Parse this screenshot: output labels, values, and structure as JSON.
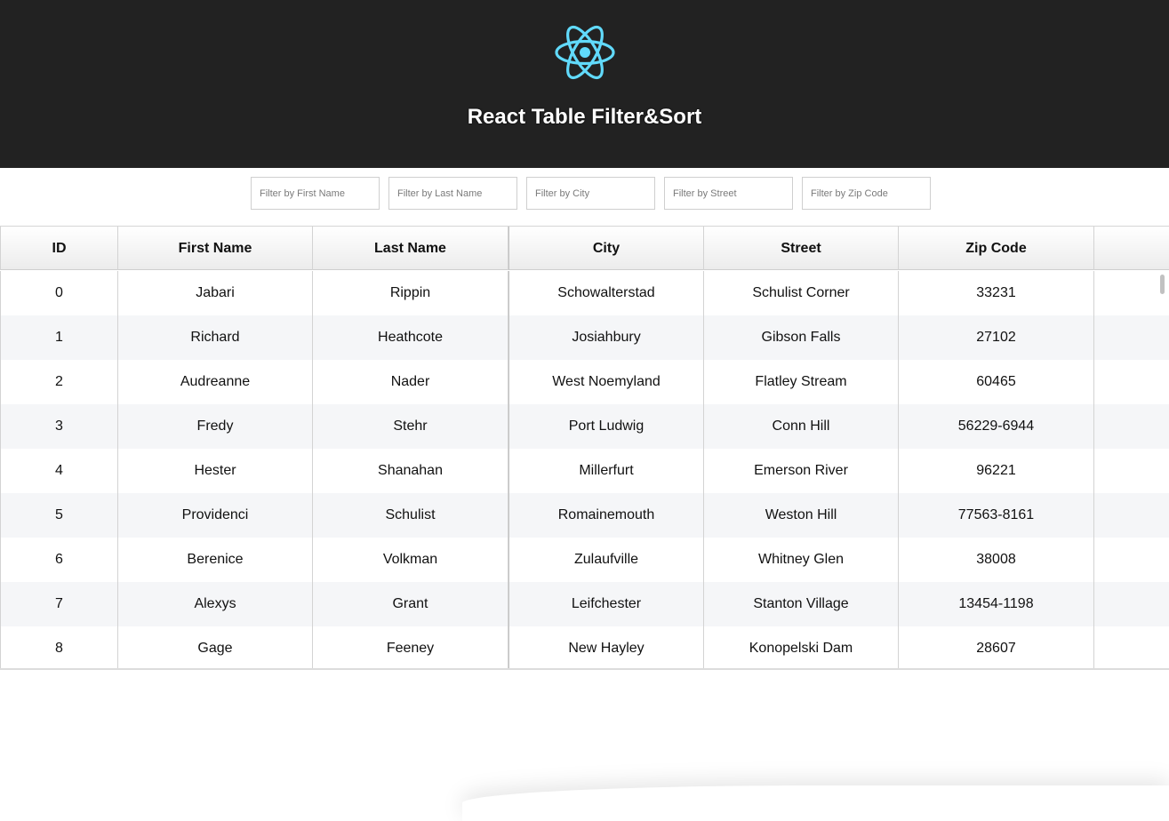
{
  "header": {
    "logo_icon": "react-atom-icon",
    "logo_color": "#61dafb",
    "title": "React Table Filter&Sort",
    "background": "#222222"
  },
  "filters": [
    {
      "placeholder": "Filter by First Name",
      "value": ""
    },
    {
      "placeholder": "Filter by Last Name",
      "value": ""
    },
    {
      "placeholder": "Filter by City",
      "value": ""
    },
    {
      "placeholder": "Filter by Street",
      "value": ""
    },
    {
      "placeholder": "Filter by Zip Code",
      "value": ""
    }
  ],
  "table": {
    "columns": [
      "ID",
      "First Name",
      "Last Name",
      "City",
      "Street",
      "Zip Code",
      ""
    ],
    "rows": [
      [
        "0",
        "Jabari",
        "Rippin",
        "Schowalterstad",
        "Schulist Corner",
        "33231"
      ],
      [
        "1",
        "Richard",
        "Heathcote",
        "Josiahbury",
        "Gibson Falls",
        "27102"
      ],
      [
        "2",
        "Audreanne",
        "Nader",
        "West Noemyland",
        "Flatley Stream",
        "60465"
      ],
      [
        "3",
        "Fredy",
        "Stehr",
        "Port Ludwig",
        "Conn Hill",
        "56229-6944"
      ],
      [
        "4",
        "Hester",
        "Shanahan",
        "Millerfurt",
        "Emerson River",
        "96221"
      ],
      [
        "5",
        "Providenci",
        "Schulist",
        "Romainemouth",
        "Weston Hill",
        "77563-8161"
      ],
      [
        "6",
        "Berenice",
        "Volkman",
        "Zulaufville",
        "Whitney Glen",
        "38008"
      ],
      [
        "7",
        "Alexys",
        "Grant",
        "Leifchester",
        "Stanton Village",
        "13454-1198"
      ],
      [
        "8",
        "Gage",
        "Feeney",
        "New Hayley",
        "Konopelski Dam",
        "28607"
      ]
    ]
  }
}
